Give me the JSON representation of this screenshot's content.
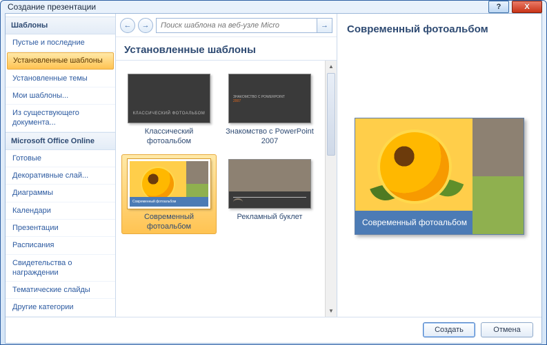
{
  "window": {
    "title": "Создание презентации",
    "help_glyph": "?",
    "close_glyph": "X"
  },
  "sidebar": {
    "header1": "Шаблоны",
    "group1": [
      "Пустые и последние",
      "Установленные шаблоны",
      "Установленные темы",
      "Мои шаблоны...",
      "Из существующего документа..."
    ],
    "selected_index": 1,
    "header2": "Microsoft Office Online",
    "group2": [
      "Готовые",
      "Декоративные слай...",
      "Диаграммы",
      "Календари",
      "Презентации",
      "Расписания",
      "Свидетельства о награждении",
      "Тематические слайды",
      "Другие категории"
    ]
  },
  "toolbar": {
    "back_glyph": "←",
    "forward_glyph": "→",
    "go_glyph": "→",
    "search_placeholder": "Поиск шаблона на веб-узле Micro"
  },
  "center": {
    "section_title": "Установленные шаблоны",
    "templates": [
      {
        "label": "Классический фотоальбом",
        "kind": "classic"
      },
      {
        "label": "Знакомство с PowerPoint 2007",
        "kind": "meet"
      },
      {
        "label": "Современный фотоальбом",
        "kind": "modern"
      },
      {
        "label": "Рекламный буклет",
        "kind": "brochure"
      }
    ],
    "selected_index": 2,
    "thumb_classic_caption": "КЛАССИЧЕСКИЙ ФОТОАЛЬБОМ",
    "thumb_meet_line1": "ЗНАКОМСТВО С POWERPOINT",
    "thumb_meet_line2": "2007",
    "thumb_modern_caption": "Современный фотоальбом"
  },
  "preview": {
    "title": "Современный фотоальбом",
    "caption": "Современный фотоальбом"
  },
  "footer": {
    "create": "Создать",
    "cancel": "Отмена"
  }
}
